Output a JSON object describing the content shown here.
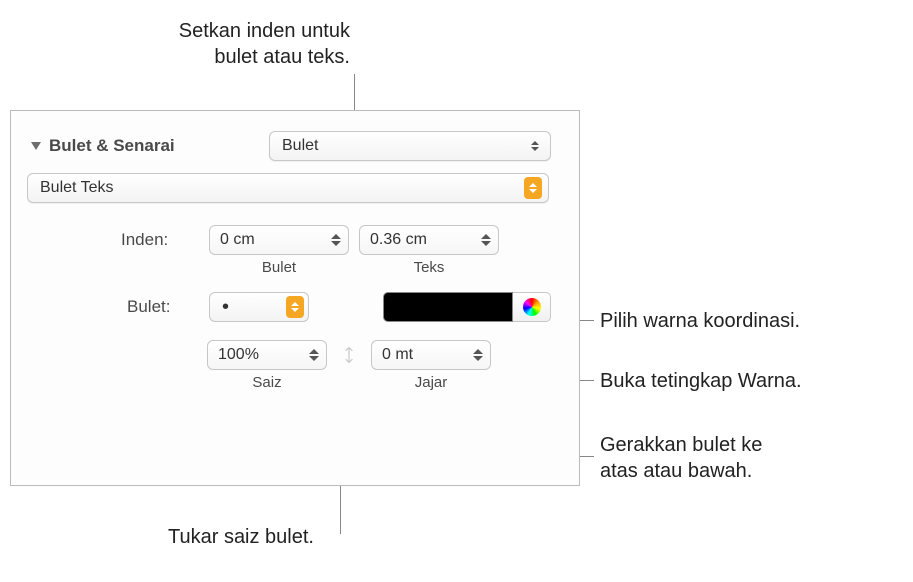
{
  "callouts": {
    "indent": "Setkan inden untuk\nbulet atau teks.",
    "color_coord": "Pilih warna koordinasi.",
    "color_window": "Buka tetingkap Warna.",
    "align": "Gerakkan bulet ke\natas atau bawah.",
    "size": "Tukar saiz bulet."
  },
  "panel": {
    "section_title": "Bulet & Senarai",
    "style_select": "Bulet",
    "type_select": "Bulet Teks",
    "indent": {
      "label": "Inden:",
      "bullet_value": "0 cm",
      "bullet_label": "Bulet",
      "text_value": "0.36 cm",
      "text_label": "Teks"
    },
    "bullet": {
      "label": "Bulet:",
      "symbol": "•"
    },
    "size": {
      "value": "100%",
      "label": "Saiz"
    },
    "align": {
      "value": "0 mt",
      "label": "Jajar"
    }
  }
}
